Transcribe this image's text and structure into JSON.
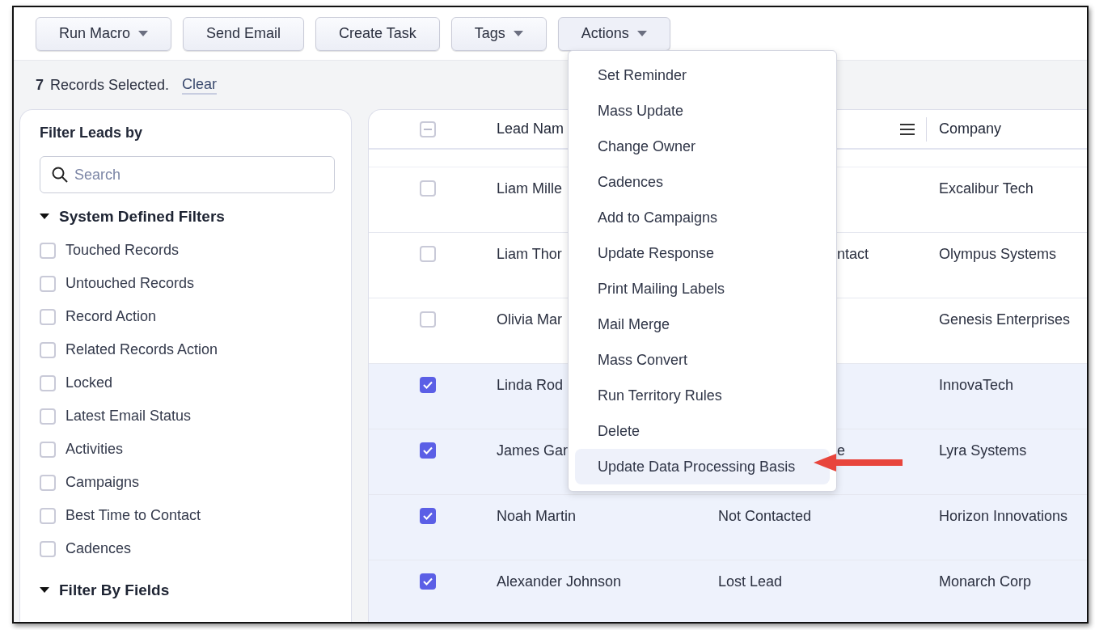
{
  "toolbar": {
    "buttons": [
      {
        "label": "Run Macro",
        "dropdown": true,
        "open": false
      },
      {
        "label": "Send Email",
        "dropdown": false,
        "open": false
      },
      {
        "label": "Create Task",
        "dropdown": false,
        "open": false
      },
      {
        "label": "Tags",
        "dropdown": true,
        "open": false
      },
      {
        "label": "Actions",
        "dropdown": true,
        "open": true
      }
    ]
  },
  "selection": {
    "count": "7",
    "text": "Records Selected.",
    "clear": "Clear"
  },
  "filters": {
    "title": "Filter Leads by",
    "search": {
      "placeholder": "Search"
    },
    "sections": [
      {
        "title": "System Defined Filters",
        "expanded": true,
        "items": [
          {
            "label": "Touched Records",
            "checked": false
          },
          {
            "label": "Untouched Records",
            "checked": false
          },
          {
            "label": "Record Action",
            "checked": false
          },
          {
            "label": "Related Records Action",
            "checked": false
          },
          {
            "label": "Locked",
            "checked": false
          },
          {
            "label": "Latest Email Status",
            "checked": false
          },
          {
            "label": "Activities",
            "checked": false
          },
          {
            "label": "Campaigns",
            "checked": false
          },
          {
            "label": "Best Time to Contact",
            "checked": false
          },
          {
            "label": "Cadences",
            "checked": false
          }
        ]
      },
      {
        "title": "Filter By Fields",
        "expanded": true
      }
    ]
  },
  "table": {
    "columns": [
      "Lead Nam",
      "Company"
    ],
    "header_partial": true,
    "rows": [
      {
        "selected": false,
        "lead_name": "Liam Mille",
        "company": "Excalibur Tech"
      },
      {
        "selected": false,
        "lead_name": "Liam Thor",
        "column_2": "ntact",
        "column_2_covered": true,
        "company": "Olympus Systems"
      },
      {
        "selected": false,
        "lead_name": "Olivia Mar",
        "company": "Genesis Enterprises"
      },
      {
        "selected": true,
        "lead_name": "Linda Rod",
        "company": "InnovaTech"
      },
      {
        "selected": true,
        "lead_name": "James Gar",
        "column_2": "e",
        "column_2_covered": true,
        "company": "Lyra Systems"
      },
      {
        "selected": true,
        "lead_name": "Noah Martin",
        "column_2": "Not Contacted",
        "column_2_covered": false,
        "company": "Horizon Innovations"
      },
      {
        "selected": true,
        "lead_name": "Alexander Johnson",
        "column_2": "Lost Lead",
        "column_2_covered": false,
        "company": "Monarch Corp"
      }
    ]
  },
  "actions_menu": {
    "items": [
      {
        "label": "Set Reminder",
        "selected": false
      },
      {
        "label": "Mass Update",
        "selected": false
      },
      {
        "label": "Change Owner",
        "selected": false
      },
      {
        "label": "Cadences",
        "selected": false
      },
      {
        "label": "Add to Campaigns",
        "selected": false
      },
      {
        "label": "Update Response",
        "selected": false
      },
      {
        "label": "Print Mailing Labels",
        "selected": false
      },
      {
        "label": "Mail Merge",
        "selected": false
      },
      {
        "label": "Mass Convert",
        "selected": false
      },
      {
        "label": "Run Territory Rules",
        "selected": false
      },
      {
        "label": "Delete",
        "selected": false
      },
      {
        "label": "Update Data Processing Basis",
        "selected": true
      }
    ]
  }
}
